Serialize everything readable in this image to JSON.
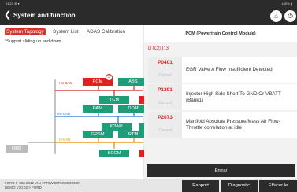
{
  "status_bar": {
    "time": "01:23 ⊛ ▾",
    "battery": "100% ▮"
  },
  "header": {
    "back_glyph": "❮",
    "title": "System and function",
    "home_icon": "home-icon",
    "exit_icon": "exit-icon"
  },
  "tabs": [
    {
      "label": "System Topology",
      "active": true
    },
    {
      "label": "System List",
      "active": false
    },
    {
      "label": "ADAS Calibration",
      "active": false
    }
  ],
  "notice": "*Support sliding up and down",
  "topology": {
    "buses": {
      "hs_can": "HS-CAN",
      "ms_can": "MS-CAN",
      "i3_can": "I3-CAN"
    },
    "gateway": "OBD",
    "nodes": {
      "pcm": "PCM",
      "abs": "ABS",
      "tcm": "TCM",
      "pam": "PAM",
      "ddm": "DDM",
      "icm": "ICM#1",
      "gpsm": "GPSM",
      "rtm": "RTM",
      "sccm": "SCCM"
    },
    "pcm_badge": "3",
    "colors": {
      "hs_can": "#d22222",
      "ms_can": "#2a6fcf",
      "i3_can": "#e08a00",
      "ok": "#1e9d79",
      "fault": "#dd2222"
    }
  },
  "panel": {
    "module_title": "PCM (Powertrain Control Module)",
    "dtc_count": "DTC(s): 3",
    "dtcs": [
      {
        "code": "P0401",
        "status": "Current",
        "description": "EGR Valve A Flow Insufficient Detected"
      },
      {
        "code": "P1291",
        "status": "Current",
        "description": "Injector High Side Short To GND Or VBATT (Bank1)"
      },
      {
        "code": "P2073",
        "status": "Current",
        "description": "Manifold Absolute Pressure/Mass Air Flow-Throttle correlation at idle"
      }
    ],
    "enter_label": "Entrar"
  },
  "footer": {
    "vehicle_line": "FORD  F-350  2012  VIN  1FT8W3DT9CEB00000",
    "demo_line": "DEMO V10.02 > FORD",
    "buttons": [
      "Rapport",
      "Diagnostic",
      "Effacer le"
    ]
  }
}
